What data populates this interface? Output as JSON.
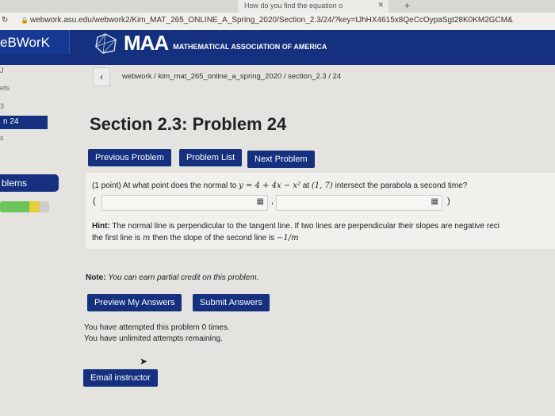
{
  "browser": {
    "tab_title": "How do you find the equation o",
    "url": "webwork.asu.edu/webwork2/Kim_MAT_265_ONLINE_A_Spring_2020/Section_2.3/24/?key=tJhHX4615x8QeCcOypaSgt28K0KM2GCM&"
  },
  "nav": {
    "brand": "eBWorK",
    "maa_big": "MAA",
    "maa_small": "MATHEMATICAL ASSOCIATION OF AMERICA"
  },
  "sidebar": {
    "items": [
      "J",
      "ets",
      "3",
      "n 24",
      "s"
    ],
    "problems_label": "blems",
    "progress": {
      "correct_fraction": 0.6,
      "partial_fraction": 0.2
    }
  },
  "breadcrumb": "webwork / kim_mat_265_online_a_spring_2020 / section_2.3 / 24",
  "title": "Section 2.3: Problem 24",
  "buttons": {
    "previous": "Previous Problem",
    "list": "Problem List",
    "next": "Next Problem",
    "preview": "Preview My Answers",
    "submit": "Submit Answers",
    "email": "Email instructor"
  },
  "problem": {
    "points": "(1 point) At what point does the normal to",
    "equation": "y = 4 + 4x − x²",
    "at": "at",
    "point": "(1, 7)",
    "rest": "intersect the parabola a second time?",
    "open_paren": "(",
    "comma": ",",
    "close_paren": ")",
    "answer1": "",
    "answer2": ""
  },
  "hint": {
    "label": "Hint:",
    "line1": "The normal line is perpendicular to the tangent line. If two lines are perpendicular their slopes are negative reci",
    "line2a": "the first line is",
    "m": "m",
    "line2b": "then the slope of the second line is",
    "neg": "−1/m"
  },
  "note": {
    "label": "Note:",
    "text": "You can earn partial credit on this problem."
  },
  "attempts": {
    "line1": "You have attempted this problem 0 times.",
    "line2": "You have unlimited attempts remaining."
  }
}
